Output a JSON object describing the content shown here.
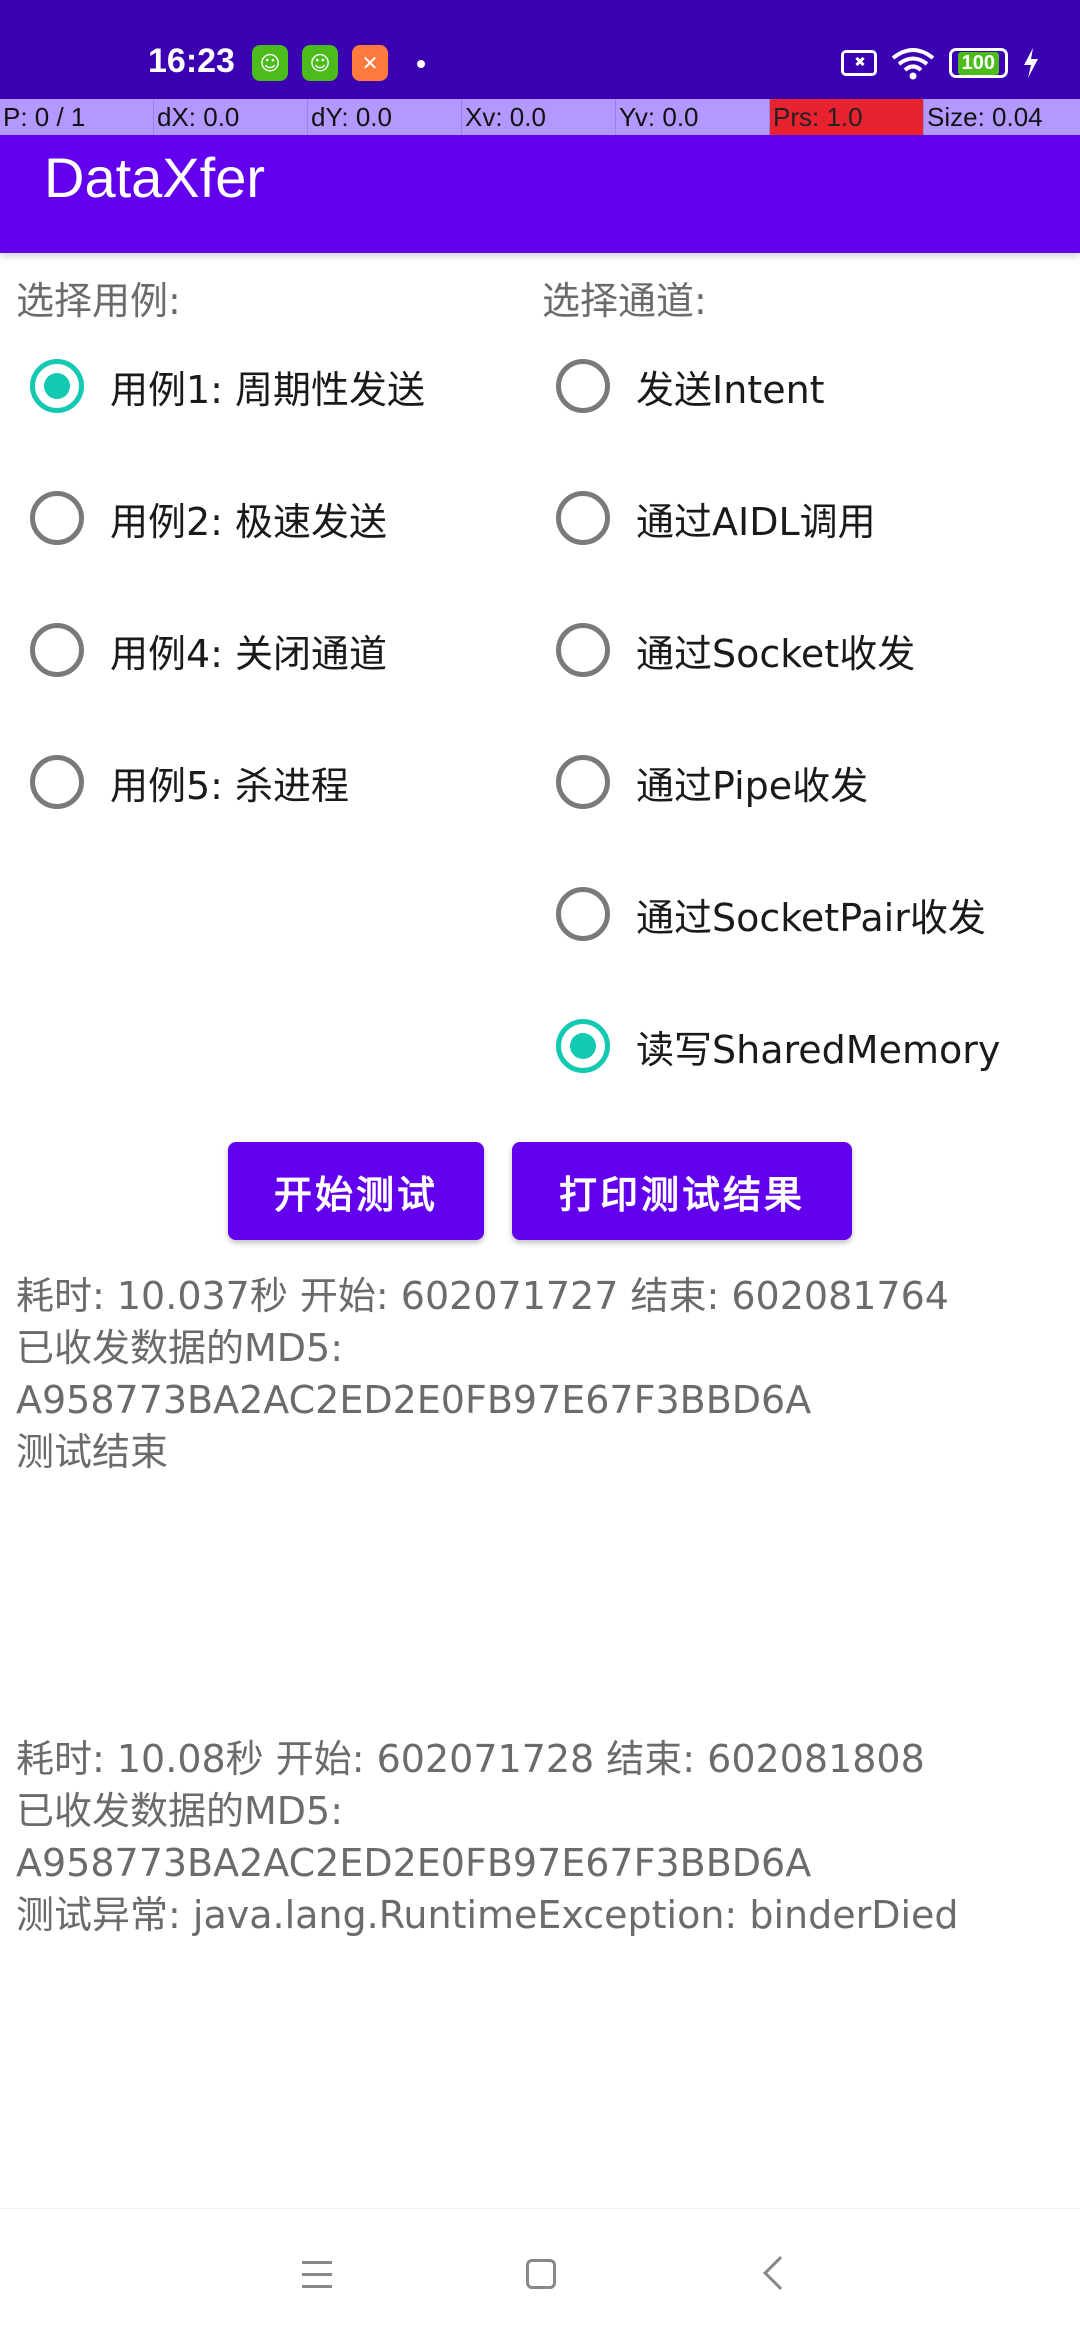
{
  "status_bar": {
    "time": "16:23",
    "battery": "100",
    "notification_icons": [
      "android-face-icon",
      "android-face-icon",
      "xiaomi-icon"
    ]
  },
  "debug_overlay": {
    "pointers": "P: 0 / 1",
    "dx": "dX: 0.0",
    "dy": "dY: 0.0",
    "xv": "Xv: 0.0",
    "yv": "Yv: 0.0",
    "prs": "Prs: 1.0",
    "size": "Size: 0.04"
  },
  "app": {
    "title": "DataXfer"
  },
  "use_case": {
    "label": "选择用例:",
    "options": [
      {
        "label": "用例1: 周期性发送",
        "checked": true
      },
      {
        "label": "用例2: 极速发送",
        "checked": false
      },
      {
        "label": "用例4: 关闭通道",
        "checked": false
      },
      {
        "label": "用例5: 杀进程",
        "checked": false
      }
    ]
  },
  "channel": {
    "label": "选择通道:",
    "options": [
      {
        "label": "发送Intent",
        "checked": false
      },
      {
        "label": "通过AIDL调用",
        "checked": false
      },
      {
        "label": "通过Socket收发",
        "checked": false
      },
      {
        "label": "通过Pipe收发",
        "checked": false
      },
      {
        "label": "通过SocketPair收发",
        "checked": false
      },
      {
        "label": "读写SharedMemory",
        "checked": true
      }
    ]
  },
  "buttons": {
    "start": "开始测试",
    "print": "打印测试结果"
  },
  "log_1": {
    "line1": "耗时: 10.037秒  开始: 602071727   结束: 602081764",
    "line2": "已收发数据的MD5:",
    "line3": "A958773BA2AC2ED2E0FB97E67F3BBD6A",
    "line4": "测试结束"
  },
  "log_2": {
    "line1": "耗时: 10.08秒  开始: 602071728   结束: 602081808",
    "line2": "已收发数据的MD5:",
    "line3": "A958773BA2AC2ED2E0FB97E67F3BBD6A",
    "line4": "测试异常: java.lang.RuntimeException: binderDied"
  },
  "colors": {
    "status_bar": "#3b00b2",
    "app_bar": "#6200ee",
    "radio_checked": "#14c9b2",
    "debug_bar": "#b399ff",
    "prs_highlight": "#e8232f"
  }
}
